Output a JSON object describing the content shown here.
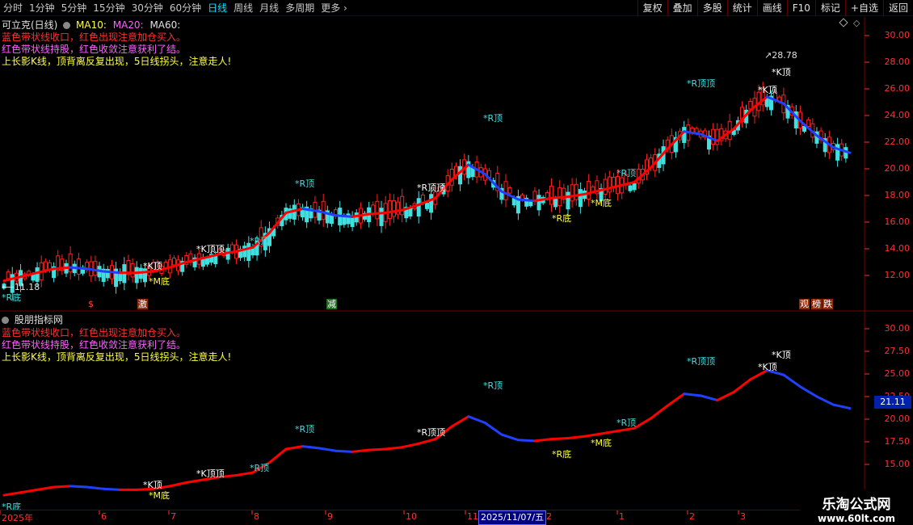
{
  "toolbar": {
    "timeframes": [
      {
        "label": "分时",
        "active": false
      },
      {
        "label": "1分钟",
        "active": false
      },
      {
        "label": "5分钟",
        "active": false
      },
      {
        "label": "15分钟",
        "active": false
      },
      {
        "label": "30分钟",
        "active": false
      },
      {
        "label": "60分钟",
        "active": false
      },
      {
        "label": "日线",
        "active": true
      },
      {
        "label": "周线",
        "active": false
      },
      {
        "label": "月线",
        "active": false
      },
      {
        "label": "多周期",
        "active": false
      },
      {
        "label": "更多",
        "active": false
      }
    ],
    "more_chevron": "›",
    "right_buttons": [
      "复权",
      "叠加",
      "多股",
      "统计",
      "画线",
      "F10",
      "标记",
      "+自选",
      "返回"
    ]
  },
  "main_panel": {
    "title": "可立克(日线)",
    "ma10": "MA10:",
    "ma20": "MA20:",
    "ma60": "MA60:",
    "info_lines": [
      {
        "text": "蓝色带状线收口，红色出现注意加仓买入。",
        "color": "#ff3030"
      },
      {
        "text": "红色带状线持股，红色收敛注意获利了结。",
        "color": "#ff60ff"
      },
      {
        "text": "上长影K线，顶背离反复出现，5日线拐头，注意走人!",
        "color": "#ffff40"
      }
    ],
    "axis_labels": [
      "30.00",
      "28.00",
      "26.00",
      "24.00",
      "22.00",
      "20.00",
      "18.00",
      "16.00",
      "14.00",
      "12.00"
    ],
    "high_label": "28.78",
    "low_label": "11.18",
    "event_markers": [
      {
        "text": "$",
        "color": "#ff4040"
      },
      {
        "text": "激",
        "color": "#ffffff"
      },
      {
        "text": "减",
        "color": "#ffffff"
      },
      {
        "text": "观",
        "color": "#ffffff"
      },
      {
        "text": "榜",
        "color": "#ffffff"
      },
      {
        "text": "跌",
        "color": "#ffffff"
      }
    ]
  },
  "sub_panel": {
    "title": "股朋指标网",
    "info_lines": [
      {
        "text": "蓝色带状线收口，红色出现注意加仓买入。",
        "color": "#ff3030"
      },
      {
        "text": "红色带状线持股，红色收敛注意获利了结。",
        "color": "#ff60ff"
      },
      {
        "text": "上长影K线，顶背离反复出现，5日线拐头，注意走人!",
        "color": "#ffff40"
      }
    ],
    "axis_labels": [
      "30.00",
      "27.50",
      "25.00",
      "22.50",
      "20.00",
      "17.50",
      "15.00"
    ],
    "current_value": "21.11"
  },
  "signals": {
    "r_top": "*R顶",
    "r_bottom": "*R底",
    "k_top": "*K顶",
    "m_bottom": "*M底",
    "k_top_dbl": "*K顶顶",
    "r_top_dbl": "*R顶顶"
  },
  "date_axis": {
    "labels": [
      "2025年",
      "6",
      "7",
      "8",
      "9",
      "10",
      "11",
      "2",
      "1",
      "2",
      "3"
    ],
    "crosshair_date": "2025/11/07/五"
  },
  "watermark": {
    "line1": "乐淘公式网",
    "line2": "www.60lt.com"
  },
  "colors": {
    "up": "#ff2020",
    "down": "#40e0e0",
    "band_red": "#ff0000",
    "band_blue": "#2040ff",
    "axis": "#ff3030",
    "grid": "#5a0000"
  },
  "chart_data": {
    "type": "candlestick",
    "series": [
      {
        "name": "MA",
        "values": [
          11.6,
          11.9,
          12.2,
          12.5,
          12.6,
          12.5,
          12.3,
          12.2,
          12.2,
          12.3,
          12.6,
          13.0,
          13.3,
          13.6,
          13.8,
          14.1,
          15.2,
          16.7,
          17.0,
          16.8,
          16.5,
          16.4,
          16.6,
          16.7,
          16.9,
          17.3,
          17.8,
          19.2,
          20.3,
          19.6,
          18.3,
          17.7,
          17.6,
          17.8,
          17.9,
          18.1,
          18.4,
          18.7,
          19.0,
          20.1,
          21.5,
          22.8,
          22.6,
          22.1,
          23.0,
          24.4,
          25.4,
          24.9,
          23.6,
          22.5,
          21.6,
          21.2
        ]
      }
    ],
    "ylim": [
      11,
      30.5
    ],
    "high": 28.78,
    "low": 11.18
  }
}
